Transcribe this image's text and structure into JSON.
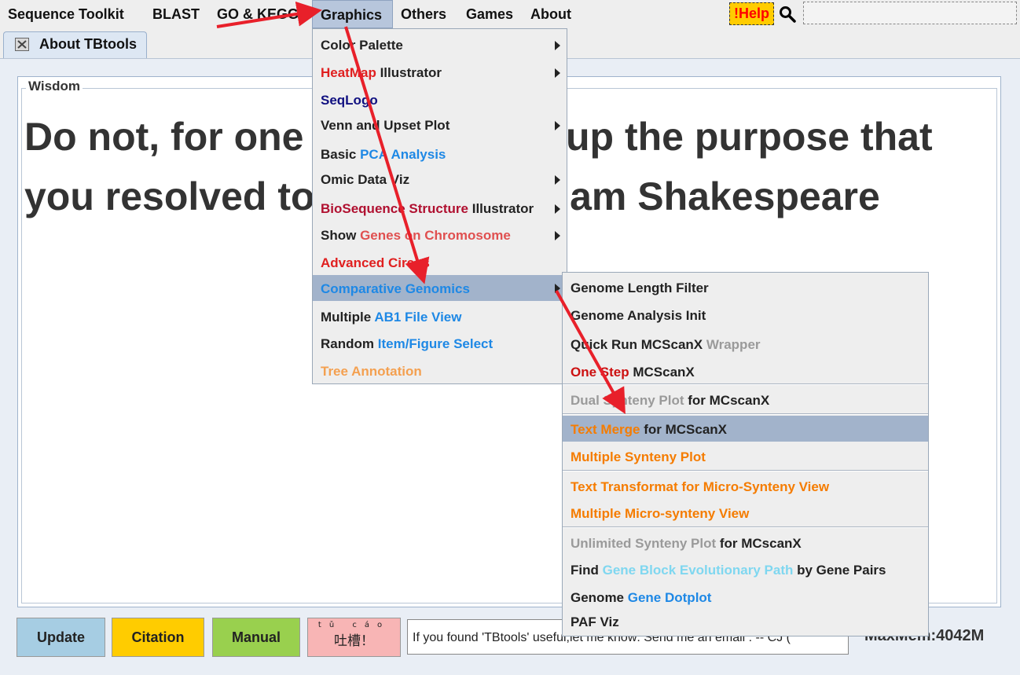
{
  "menubar": {
    "items": [
      "Sequence Toolkit",
      "BLAST",
      "GO & KEGG",
      "Graphics",
      "Others",
      "Games",
      "About"
    ],
    "help_label": "!Help"
  },
  "tab": {
    "label": "About TBtools"
  },
  "wisdom": {
    "label": "Wisdom",
    "quote": "Do not, for one repulse, give up the purpose that you resolved to effect. -- William Shakespeare"
  },
  "buttons": {
    "update": "Update",
    "citation": "Citation",
    "manual": "Manual",
    "tucao_pinyin": "tǔ cáo",
    "tucao": "吐槽！"
  },
  "message": "If you found 'TBtools' useful,let me know: Send me an email : -- CJ (",
  "maxmem": "MaxMem:4042M",
  "graphics_menu": {
    "color_palette": "Color Palette",
    "heatmap_a": "HeatMap",
    "heatmap_b": " Illustrator",
    "seqlogo": "SeqLogo",
    "venn": "Venn and Upset Plot",
    "pca_a": "Basic ",
    "pca_b": "PCA Analysis",
    "omic": "Omic Data Viz",
    "bioseq_a": "BioSequence Structure",
    "bioseq_b": " Illustrator",
    "show_a": "Show ",
    "show_b": "Genes on Chromosome",
    "circos": "Advanced Circos",
    "comparative": "Comparative Genomics",
    "ab1_a": "Multiple ",
    "ab1_b": "AB1 File View",
    "random_a": "Random ",
    "random_b": "Item/Figure Select",
    "tree": "Tree Annotation"
  },
  "cg_menu": {
    "length_filter": "Genome Length Filter",
    "analysis_init": "Genome Analysis Init",
    "quick_a": "Quick Run MCScanX",
    "quick_b": " Wrapper",
    "onestep_a": "One Step",
    "onestep_b": " MCScanX",
    "dual_a": "Dual Synteny Plot",
    "dual_b": " for MCscanX",
    "textmerge_a": "Text Merge",
    "textmerge_b": " for MCScanX",
    "multi_synteny": "Multiple Synteny Plot",
    "text_transformat": "Text Transformat for Micro-Synteny View",
    "multi_micro": "Multiple Micro-synteny View",
    "unlimited_a": "Unlimited Synteny Plot",
    "unlimited_b": " for MCscanX",
    "find_a": "Find ",
    "find_b": "Gene Block Evolutionary Path",
    "find_c": " by Gene Pairs",
    "dotplot_a": "Genome ",
    "dotplot_b": "Gene Dotplot",
    "paf": "PAF Viz"
  }
}
